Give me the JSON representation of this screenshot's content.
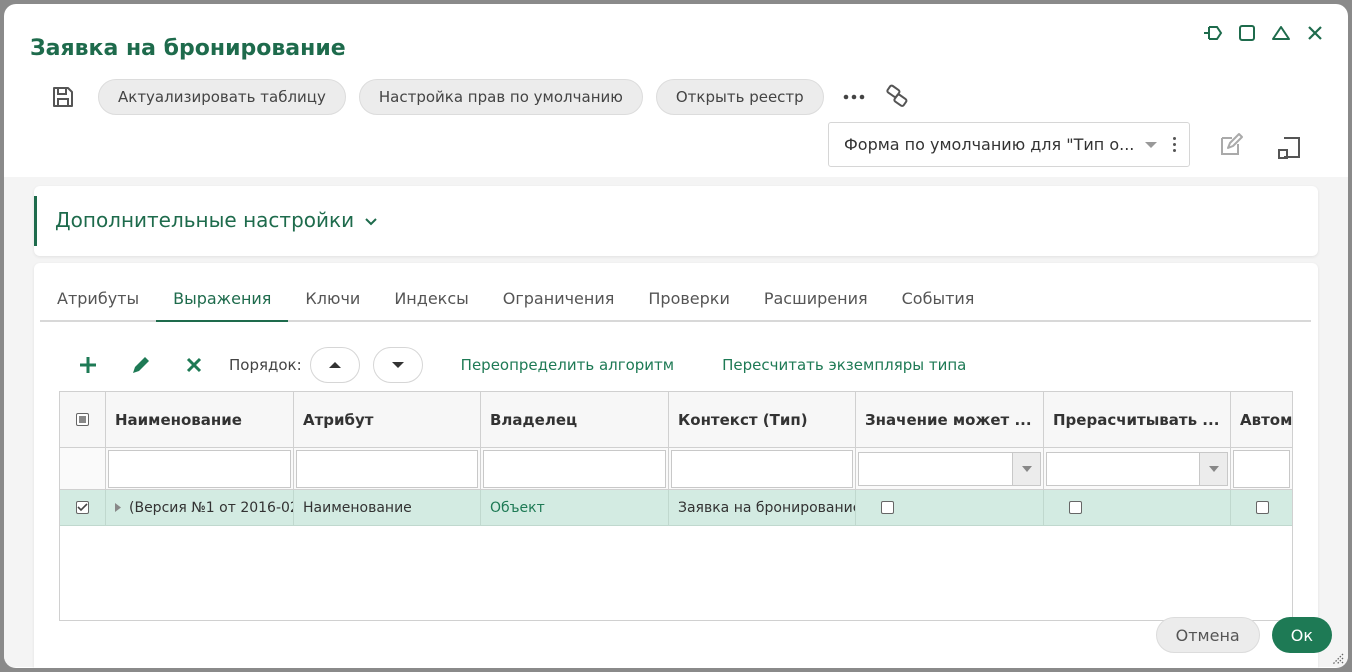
{
  "dialog": {
    "title": "Заявка на бронирование"
  },
  "toolbar": {
    "buttons": [
      "Актуализировать таблицу",
      "Настройка прав по умолчанию",
      "Открыть реестр"
    ]
  },
  "form_select": {
    "value": "Форма по умолчанию для \"Тип о..."
  },
  "section": {
    "title": "Дополнительные настройки"
  },
  "tabs": [
    "Атрибуты",
    "Выражения",
    "Ключи",
    "Индексы",
    "Ограничения",
    "Проверки",
    "Расширения",
    "События"
  ],
  "active_tab": "Выражения",
  "grid_toolbar": {
    "order_label": "Порядок:",
    "link_override": "Переопределить алгоритм",
    "link_recalc": "Пересчитать экземпляры типа"
  },
  "grid": {
    "columns": [
      "Наименование",
      "Атрибут",
      "Владелец",
      "Контекст (Тип)",
      "Значение может ...",
      "Прерасчитывать ...",
      "Автом"
    ],
    "rows": [
      {
        "name": "(Версия №1 от 2016-02",
        "attribute": "Наименование",
        "owner": "Объект",
        "context": "Заявка на бронирование",
        "nullable": false,
        "recalc": false,
        "auto": false,
        "selected": true
      }
    ]
  },
  "footer": {
    "cancel": "Отмена",
    "ok": "Ок"
  },
  "colors": {
    "accent": "#1e6b4c",
    "row_selected": "#d3ebe2"
  }
}
